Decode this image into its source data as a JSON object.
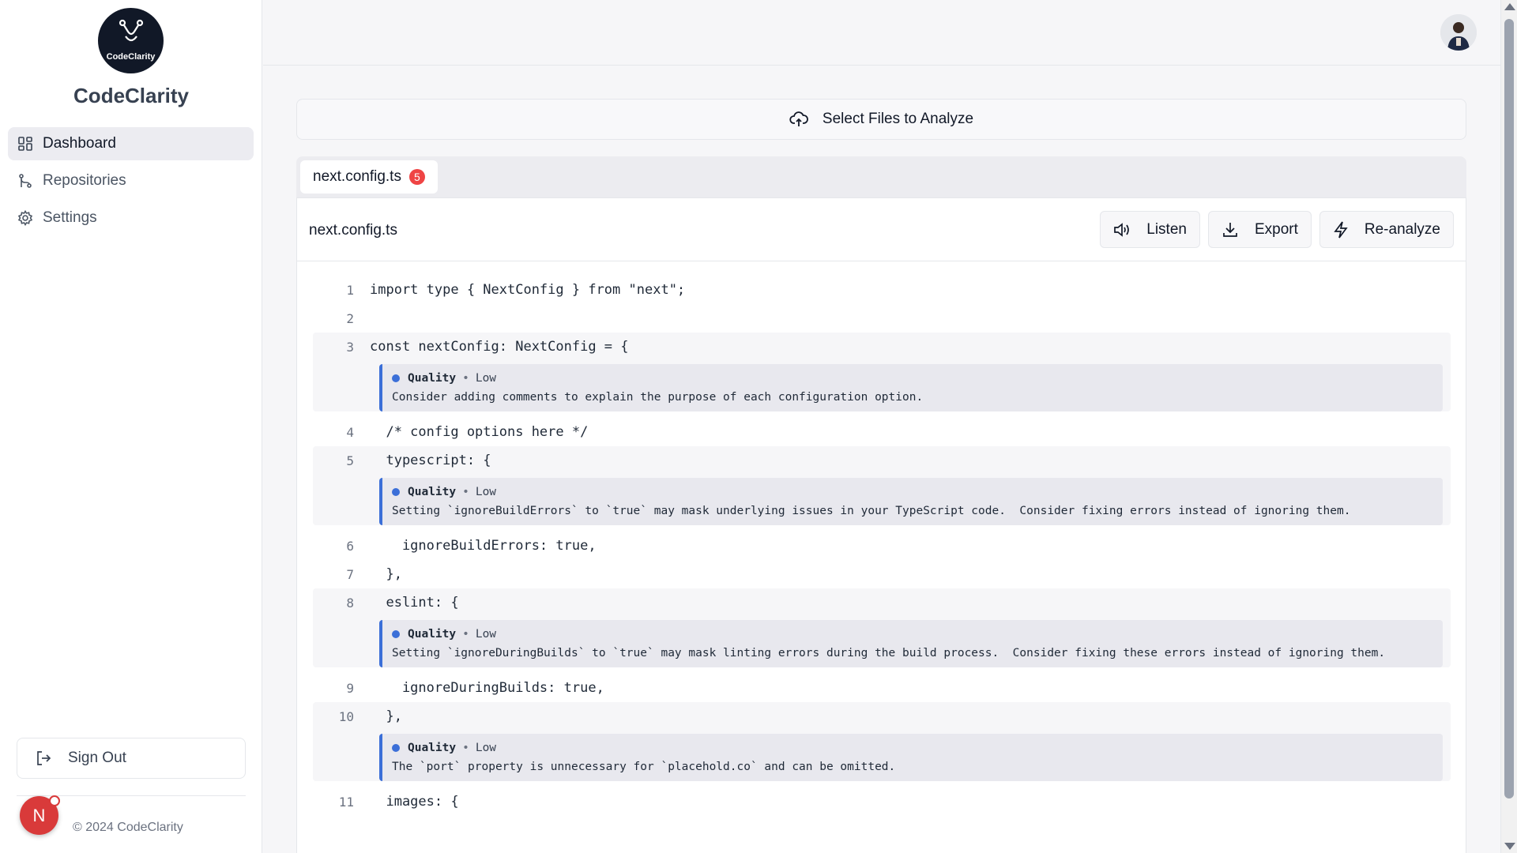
{
  "app": {
    "name": "CodeClarity",
    "logo_text": "CodeClarity"
  },
  "sidebar": {
    "items": [
      {
        "label": "Dashboard",
        "icon": "dashboard-icon",
        "active": true
      },
      {
        "label": "Repositories",
        "icon": "git-branch-icon",
        "active": false
      },
      {
        "label": "Settings",
        "icon": "gear-icon",
        "active": false
      }
    ],
    "sign_out_label": "Sign Out",
    "copyright": "© 2024 CodeClarity",
    "avatar_initial": "N"
  },
  "main": {
    "select_files_label": "Select Files to Analyze",
    "tab": {
      "label": "next.config.ts",
      "count": "5"
    },
    "file_title": "next.config.ts",
    "actions": {
      "listen": "Listen",
      "export": "Export",
      "reanalyze": "Re-analyze"
    }
  },
  "code": {
    "l1": {
      "num": "1",
      "text": "import type { NextConfig } from \"next\";"
    },
    "l2": {
      "num": "2",
      "text": ""
    },
    "l3": {
      "num": "3",
      "text": "const nextConfig: NextConfig = {"
    },
    "l4": {
      "num": "4",
      "text": "  /* config options here */"
    },
    "l5": {
      "num": "5",
      "text": "  typescript: {"
    },
    "l6": {
      "num": "6",
      "text": "    ignoreBuildErrors: true,"
    },
    "l7": {
      "num": "7",
      "text": "  },"
    },
    "l8": {
      "num": "8",
      "text": "  eslint: {"
    },
    "l9": {
      "num": "9",
      "text": "    ignoreDuringBuilds: true,"
    },
    "l10": {
      "num": "10",
      "text": "  },"
    },
    "l11": {
      "num": "11",
      "text": "  images: {"
    }
  },
  "issues": {
    "i1": {
      "category": "Quality",
      "severity": "Low",
      "message": "Consider adding comments to explain the purpose of each configuration option."
    },
    "i2": {
      "category": "Quality",
      "severity": "Low",
      "message": "Setting `ignoreBuildErrors` to `true` may mask underlying issues in your TypeScript code.  Consider fixing errors instead of ignoring them."
    },
    "i3": {
      "category": "Quality",
      "severity": "Low",
      "message": "Setting `ignoreDuringBuilds` to `true` may mask linting errors during the build process.  Consider fixing these errors instead of ignoring them."
    },
    "i4": {
      "category": "Quality",
      "severity": "Low",
      "message": "The `port` property is unnecessary for `placehold.co` and can be omitted."
    }
  },
  "colors": {
    "accent": "#3b6fd8",
    "badge": "#ef4444",
    "avatar": "#d93a3a"
  }
}
